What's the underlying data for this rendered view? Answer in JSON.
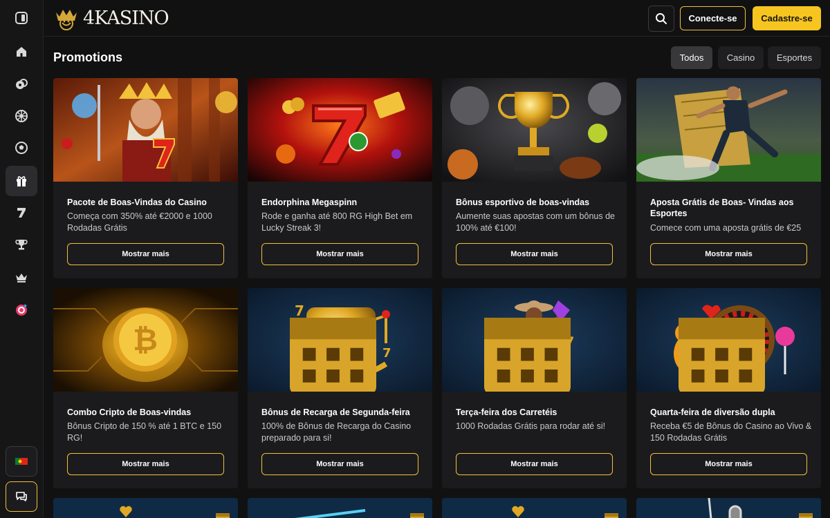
{
  "brand": {
    "name": "4KASINO"
  },
  "header": {
    "login_label": "Conecte-se",
    "signup_label": "Cadastre-se"
  },
  "page": {
    "title": "Promotions"
  },
  "filters": [
    {
      "label": "Todos",
      "active": true
    },
    {
      "label": "Casino",
      "active": false
    },
    {
      "label": "Esportes",
      "active": false
    }
  ],
  "sidebar": {
    "items": [
      {
        "icon": "sidebar-toggle-icon"
      },
      {
        "icon": "home-icon"
      },
      {
        "icon": "casino-chips-icon"
      },
      {
        "icon": "live-casino-roulette-icon"
      },
      {
        "icon": "sports-ball-icon"
      },
      {
        "icon": "promotions-gift-icon",
        "active": true
      },
      {
        "icon": "slots-seven-icon"
      },
      {
        "icon": "tournament-trophy-icon"
      },
      {
        "icon": "vip-crown-icon"
      },
      {
        "icon": "wheel-bonus-icon"
      }
    ],
    "language_icon": "portugal-flag-icon",
    "chat_icon": "chat-icon"
  },
  "promotions": [
    {
      "title": "Pacote de Boas-Vindas do Casino",
      "desc": "Começa com 350% até €2000 e 1000 Rodadas Grátis",
      "button": "Mostrar mais"
    },
    {
      "title": "Endorphina Megaspinn",
      "desc": "Rode e ganha até 800 RG High Bet em Lucky Streak 3!",
      "button": "Mostrar mais"
    },
    {
      "title": "Bônus esportivo de boas-vindas",
      "desc": "Aumente suas apostas com um bônus de 100% até €100!",
      "button": "Mostrar mais"
    },
    {
      "title": "Aposta Grátis de Boas- Vindas aos Esportes",
      "desc": "Comece com uma aposta grátis de €25",
      "button": "Mostrar mais"
    },
    {
      "title": "Combo Cripto de Boas-vindas",
      "desc": "Bônus Cripto de 150 % até 1 BTC e 150 RG!",
      "button": "Mostrar mais"
    },
    {
      "title": "Bônus de Recarga de Segunda-feira",
      "desc": "100% de Bônus de Recarga do Casino preparado para si!",
      "button": "Mostrar mais"
    },
    {
      "title": "Terça-feira dos Carretéis",
      "desc": "1000 Rodadas Grátis para rodar até si!",
      "button": "Mostrar mais"
    },
    {
      "title": "Quarta-feira de diversão dupla",
      "desc": "Receba €5 de Bônus do Casino ao Vivo & 150 Rodadas Grátis",
      "button": "Mostrar mais"
    }
  ],
  "colors": {
    "accent": "#f7c51f",
    "background": "#111112",
    "card": "#1b1b1d"
  }
}
